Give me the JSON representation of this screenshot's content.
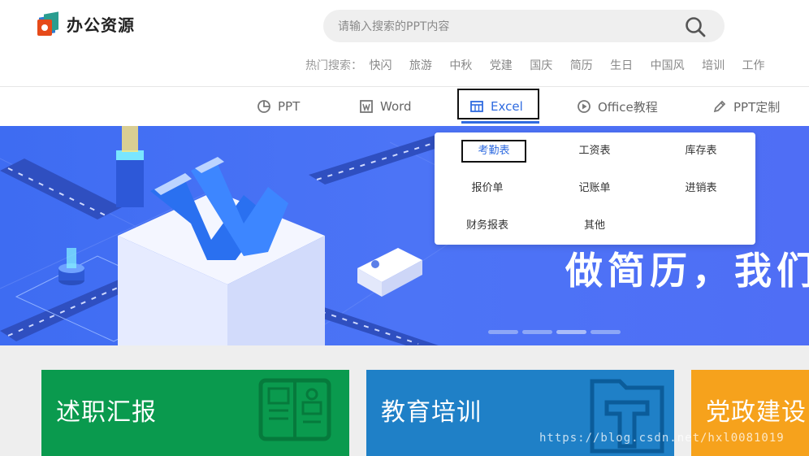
{
  "logo": {
    "text": "办公资源"
  },
  "search": {
    "placeholder": "请输入搜索的PPT内容"
  },
  "hot_search": {
    "label": "热门搜索：",
    "keywords": [
      "快闪",
      "旅游",
      "中秋",
      "党建",
      "国庆",
      "简历",
      "生日",
      "中国风",
      "培训",
      "工作"
    ]
  },
  "nav": {
    "items": [
      {
        "label": "PPT",
        "icon": "pie-chart-icon"
      },
      {
        "label": "Word",
        "icon": "word-icon"
      },
      {
        "label": "Excel",
        "icon": "excel-table-icon",
        "active": true
      },
      {
        "label": "Office教程",
        "icon": "play-circle-icon"
      },
      {
        "label": "PPT定制",
        "icon": "pen-icon"
      }
    ],
    "accent": "#2f6be0"
  },
  "dropdown": {
    "items": [
      "考勤表",
      "工资表",
      "库存表",
      "报价单",
      "记账单",
      "进销表",
      "财务报表",
      "其他"
    ],
    "selected": "考勤表"
  },
  "banner": {
    "slogan": "做简历，我们",
    "slide_count": 4,
    "active_slide": 2,
    "colors": {
      "bg": "#4c74f6"
    }
  },
  "cards": [
    {
      "title": "述职汇报",
      "color": "#0a9a4e",
      "icon": "presentation-board-icon"
    },
    {
      "title": "教育培训",
      "color": "#1f80c7",
      "icon": "folder-t-icon"
    },
    {
      "title": "党政建设",
      "color": "#f6a21c",
      "icon": ""
    }
  ],
  "watermark": "https://blog.csdn.net/hxl0081019"
}
